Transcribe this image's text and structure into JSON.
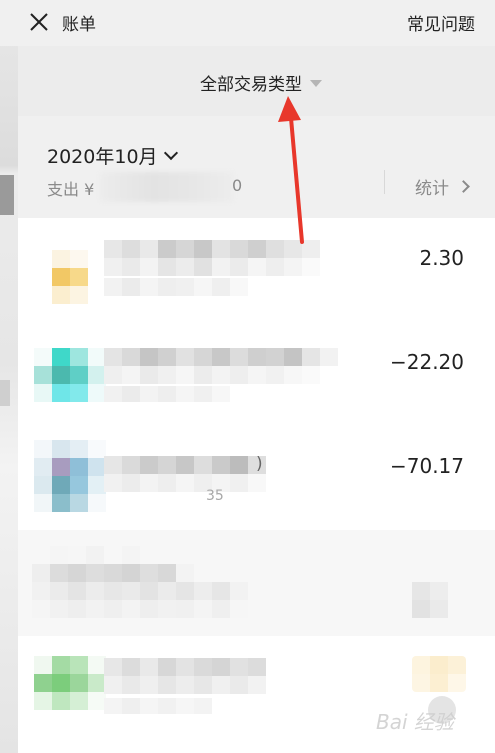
{
  "header": {
    "title": "账单",
    "faq_label": "常见问题"
  },
  "filter": {
    "label": "全部交易类型"
  },
  "summary": {
    "month": "2020年10月",
    "expense_prefix": "支出 ¥",
    "expense_tail": "0",
    "stats_label": "统计"
  },
  "transactions": [
    {
      "amount": "2.30"
    },
    {
      "amount": "−22.20"
    },
    {
      "amount": "−70.17",
      "title_tail": ")",
      "meta_tail": "35"
    },
    {
      "amount": ""
    },
    {
      "amount": ""
    }
  ],
  "colors": {
    "annotation_arrow": "#e8372b",
    "background": "#f0f0f0"
  },
  "watermark": {
    "text": "Bai 经验"
  }
}
